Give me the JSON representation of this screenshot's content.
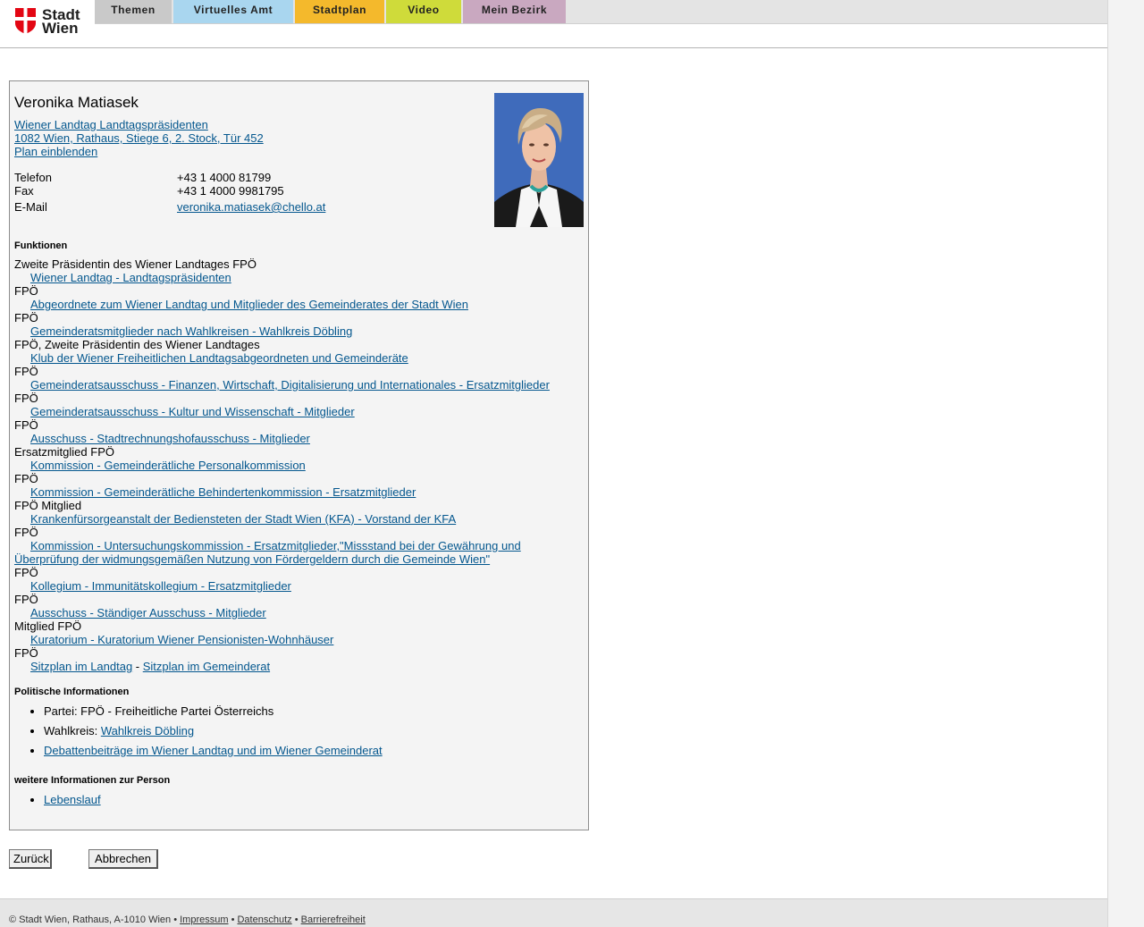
{
  "header": {
    "logo_line1": "Stadt",
    "logo_line2": "Wien",
    "nav": [
      "Themen",
      "Virtuelles Amt",
      "Stadtplan",
      "Video",
      "Mein Bezirk"
    ]
  },
  "person": {
    "name": "Veronika Matiasek",
    "org_link": "Wiener Landtag Landtagspräsidenten",
    "address_link": "1082 Wien, Rathaus, Stiege 6, 2. Stock, Tür 452",
    "map_link": "Plan einblenden",
    "phone_label": "Telefon",
    "phone": "+43 1 4000 81799",
    "fax_label": "Fax",
    "fax": "+43 1 4000 9981795",
    "email_label": "E-Mail",
    "email": "veronika.matiasek@chello.at"
  },
  "functions_title": "Funktionen",
  "functions": [
    {
      "role": "Zweite Präsidentin des Wiener Landtages FPÖ",
      "link": "Wiener Landtag - Landtagspräsidenten"
    },
    {
      "role": "FPÖ",
      "link": "Abgeordnete zum Wiener Landtag und Mitglieder des Gemeinderates der Stadt Wien"
    },
    {
      "role": "FPÖ",
      "link": "Gemeinderatsmitglieder nach Wahlkreisen - Wahlkreis Döbling"
    },
    {
      "role": "FPÖ, Zweite Präsidentin des Wiener Landtages",
      "link": "Klub der Wiener Freiheitlichen Landtagsabgeordneten und Gemeinderäte"
    },
    {
      "role": "FPÖ",
      "link": "Gemeinderatsausschuss - Finanzen, Wirtschaft, Digitalisierung und Internationales - Ersatzmitglieder"
    },
    {
      "role": "FPÖ",
      "link": "Gemeinderatsausschuss - Kultur und Wissenschaft - Mitglieder"
    },
    {
      "role": "FPÖ",
      "link": "Ausschuss - Stadtrechnungshofausschuss - Mitglieder"
    },
    {
      "role": "Ersatzmitglied FPÖ",
      "link": "Kommission - Gemeinderätliche Personalkommission"
    },
    {
      "role": "FPÖ",
      "link": "Kommission - Gemeinderätliche Behindertenkommission - Ersatzmitglieder"
    },
    {
      "role": "FPÖ Mitglied",
      "link": "Krankenfürsorgeanstalt der Bediensteten der Stadt Wien (KFA) - Vorstand der KFA"
    },
    {
      "role": "FPÖ",
      "link": "Kommission - Untersuchungskommission - Ersatzmitglieder,\"Missstand bei der Gewährung und Überprüfung der widmungsgemäßen Nutzung von Fördergeldern durch die Gemeinde Wien\"",
      "long": true
    },
    {
      "role": "FPÖ",
      "link": "Kollegium - Immunitätskollegium - Ersatzmitglieder"
    },
    {
      "role": "FPÖ",
      "link": "Ausschuss - Ständiger Ausschuss - Mitglieder"
    },
    {
      "role": "Mitglied FPÖ",
      "link": "Kuratorium - Kuratorium Wiener Pensionisten-Wohnhäuser"
    },
    {
      "role": "FPÖ",
      "link": ""
    }
  ],
  "seat_links": {
    "landtag": "Sitzplan im Landtag",
    "separator": " - ",
    "gemeinderat": "Sitzplan im Gemeinderat"
  },
  "political_title": "Politische Informationen",
  "political": {
    "party": "Partei: FPÖ - Freiheitliche Partei Österreichs",
    "district_label": "Wahlkreis: ",
    "district_link": "Wahlkreis Döbling",
    "debates_link": "Debattenbeiträge im Wiener Landtag und im Wiener Gemeinderat"
  },
  "more_title": "weitere Informationen zur Person",
  "more": {
    "cv_link": "Lebenslauf"
  },
  "buttons": {
    "back": "Zurück",
    "cancel": "Abbrechen"
  },
  "footer": {
    "copyright": "© Stadt Wien, Rathaus, A-1010 Wien • ",
    "impressum": "Impressum",
    "sep": " • ",
    "datenschutz": "Datenschutz",
    "barrierefreiheit": "Barrierefreiheit"
  },
  "colors": {
    "link": "#04578e",
    "nav_themen": "#c9c9c9",
    "nav_amt": "#a9d6ef",
    "nav_plan": "#f4b92c",
    "nav_video": "#cfdb3a",
    "nav_bezirk": "#c9a8c0",
    "logo_red": "#e30613"
  }
}
